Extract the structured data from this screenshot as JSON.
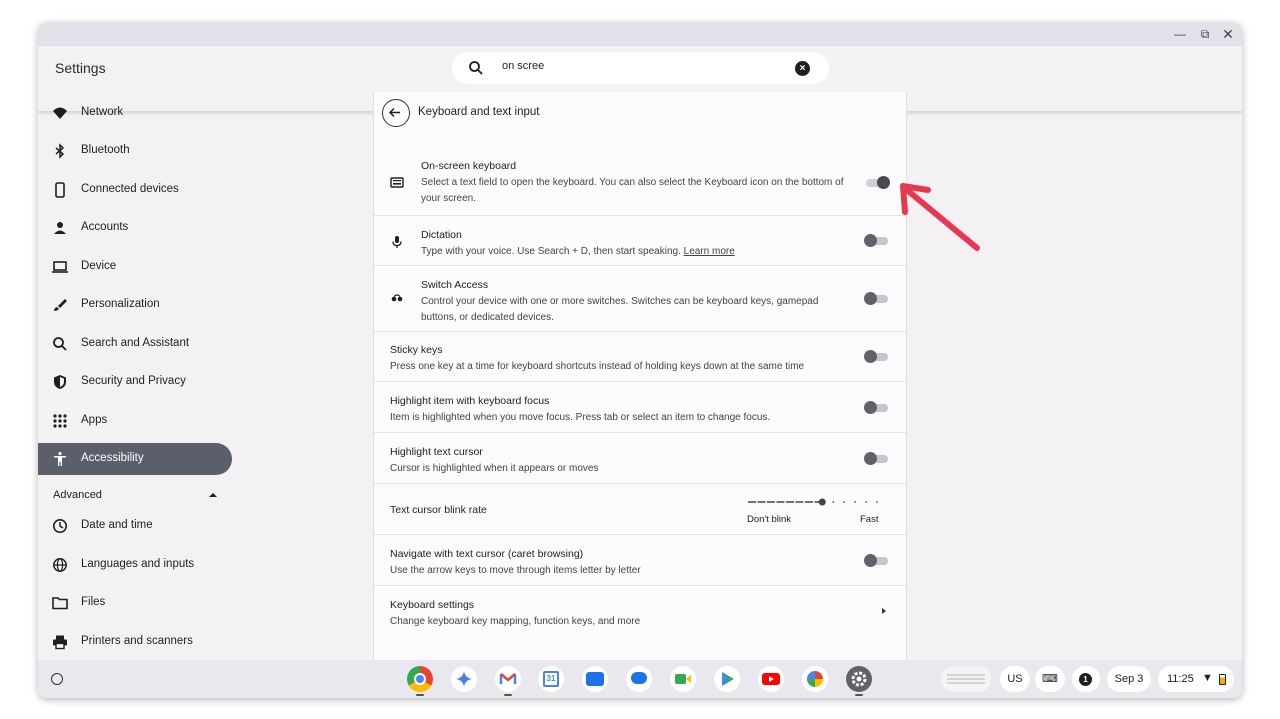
{
  "window": {
    "title": "Settings",
    "controls": [
      "minimize-icon",
      "maximize-icon",
      "close-icon"
    ]
  },
  "search": {
    "value": "on scree",
    "icon": "search-icon",
    "clear_icon": "clear-icon"
  },
  "sidebar": {
    "items": [
      {
        "label": "Network",
        "icon": "wifi-icon"
      },
      {
        "label": "Bluetooth",
        "icon": "bluetooth-icon"
      },
      {
        "label": "Connected devices",
        "icon": "phone-icon"
      },
      {
        "label": "Accounts",
        "icon": "person-icon"
      },
      {
        "label": "Device",
        "icon": "laptop-icon"
      },
      {
        "label": "Personalization",
        "icon": "brush-icon"
      },
      {
        "label": "Search and Assistant",
        "icon": "search-icon"
      },
      {
        "label": "Security and Privacy",
        "icon": "shield-icon"
      },
      {
        "label": "Apps",
        "icon": "apps-grid-icon"
      },
      {
        "label": "Accessibility",
        "icon": "accessibility-icon",
        "active": true
      }
    ],
    "advanced_label": "Advanced",
    "advanced_items": [
      {
        "label": "Date and time",
        "icon": "clock-icon"
      },
      {
        "label": "Languages and inputs",
        "icon": "globe-icon"
      },
      {
        "label": "Files",
        "icon": "folder-icon"
      },
      {
        "label": "Printers and scanners",
        "icon": "printer-icon"
      }
    ]
  },
  "panel": {
    "title": "Keyboard and text input",
    "rows": [
      {
        "title": "On-screen keyboard",
        "desc": "Select a text field to open the keyboard. You can also select the Keyboard icon on the bottom of your screen.",
        "icon": "keyboard-icon",
        "toggle": true
      },
      {
        "title": "Dictation",
        "desc": "Type with your voice. Use Search + D, then start speaking.",
        "link": "Learn more",
        "icon": "mic-icon",
        "toggle": false
      },
      {
        "title": "Switch Access",
        "desc": "Control your device with one or more switches. Switches can be keyboard keys, gamepad buttons, or dedicated devices.",
        "icon": "switch-access-icon",
        "toggle": false
      },
      {
        "title": "Sticky keys",
        "desc": "Press one key at a time for keyboard shortcuts instead of holding keys down at the same time",
        "toggle": false
      },
      {
        "title": "Highlight item with keyboard focus",
        "desc": "Item is highlighted when you move focus. Press tab or select an item to change focus.",
        "toggle": false
      },
      {
        "title": "Highlight text cursor",
        "desc": "Cursor is highlighted when it appears or moves",
        "toggle": false
      },
      {
        "title": "Text cursor blink rate",
        "slider_min_label": "Don't blink",
        "slider_max_label": "Fast",
        "slider_value_fraction": 0.57
      },
      {
        "title": "Navigate with text cursor (caret browsing)",
        "desc": "Use the arrow keys to move through items letter by letter",
        "toggle": false
      },
      {
        "title": "Keyboard settings",
        "desc": "Change keyboard key mapping, function keys, and more"
      }
    ]
  },
  "annotation": {
    "arrow_color": "#e8384f"
  },
  "shelf": {
    "apps": [
      "chrome-icon",
      "gemini-icon",
      "gmail-icon",
      "calendar-icon",
      "files-icon",
      "messages-icon",
      "meet-icon",
      "play-store-icon",
      "youtube-icon",
      "photos-icon",
      "settings-icon"
    ],
    "calendar_day": "31",
    "ime": "US",
    "notification_count": "1",
    "date": "Sep 3",
    "time": "11:25"
  }
}
